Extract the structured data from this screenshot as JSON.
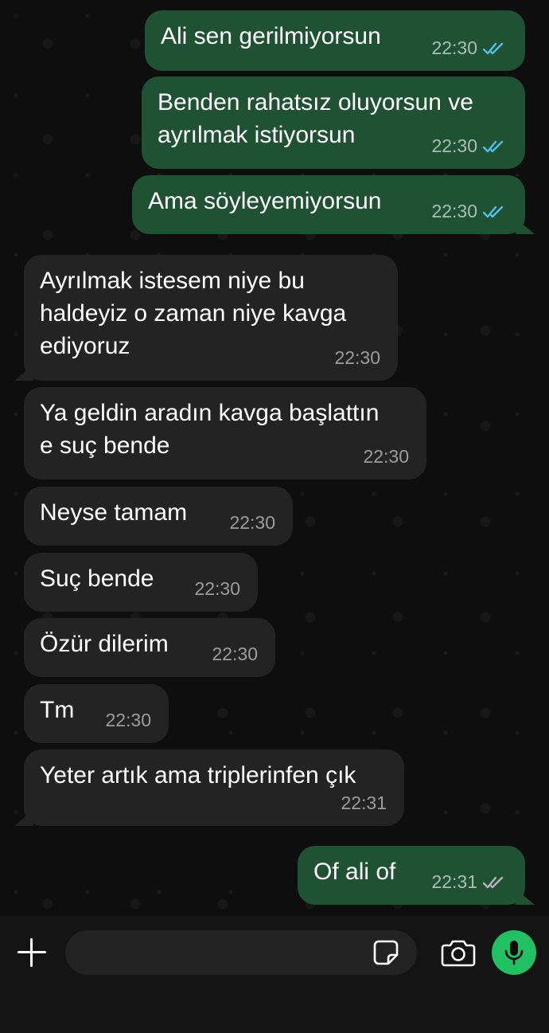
{
  "messages": [
    {
      "direction": "outgoing",
      "text": "Ali sen gerilmiyorsun",
      "time": "22:30",
      "status": "read"
    },
    {
      "direction": "outgoing",
      "text": "Benden rahatsız oluyorsun ve\nayrılmak istiyorsun",
      "time": "22:30",
      "status": "read"
    },
    {
      "direction": "outgoing",
      "text": "Ama söyleyemiyorsun",
      "time": "22:30",
      "status": "read"
    },
    {
      "direction": "incoming",
      "text": "Ayrılmak istesem niye bu\nhaldeyiz o zaman niye kavga\nediyoruz",
      "time": "22:30"
    },
    {
      "direction": "incoming",
      "text": "Ya geldin aradın kavga başlattın\ne suç bende",
      "time": "22:30"
    },
    {
      "direction": "incoming",
      "text": "Neyse tamam",
      "time": "22:30"
    },
    {
      "direction": "incoming",
      "text": "Suç bende",
      "time": "22:30"
    },
    {
      "direction": "incoming",
      "text": "Özür dilerim",
      "time": "22:30"
    },
    {
      "direction": "incoming",
      "text": "Tm",
      "time": "22:30"
    },
    {
      "direction": "incoming",
      "text": "Yeter artık ama triplerinfen çık",
      "time": "22:31"
    },
    {
      "direction": "outgoing",
      "text": "Of ali of",
      "time": "22:31",
      "status": "delivered"
    }
  ],
  "input_bar": {
    "message_value": "",
    "icons": [
      "plus-icon",
      "sticker-icon",
      "camera-icon",
      "microphone-icon"
    ]
  },
  "colors": {
    "outgoing_bubble": "#1f5133",
    "incoming_bubble": "#232323",
    "read_tick": "#53bdeb",
    "delivered_tick": "#9a9a9a",
    "mic_button": "#21c063"
  }
}
